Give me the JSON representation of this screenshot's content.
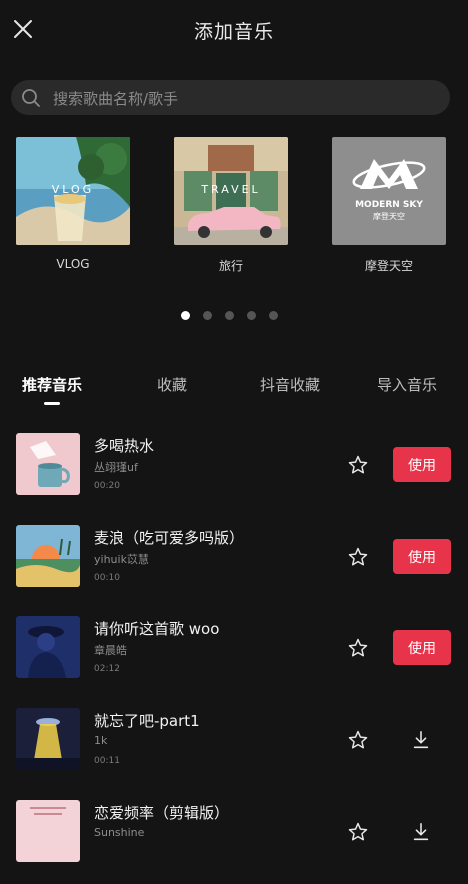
{
  "header": {
    "title": "添加音乐"
  },
  "search": {
    "placeholder": "搜索歌曲名称/歌手"
  },
  "categories": [
    {
      "label": "VLOG",
      "overlay": "VLOG",
      "thumb": "vlog-drink-photo"
    },
    {
      "label": "旅行",
      "overlay": "TRAVEL",
      "thumb": "travel-pink-car-photo"
    },
    {
      "label": "摩登天空",
      "overlay": "MODERN SKY",
      "overlay_sub": "摩登天空",
      "thumb": "modern-sky-logo"
    }
  ],
  "carousel": {
    "page_count": 5,
    "active_index": 0
  },
  "tabs": [
    {
      "label": "推荐音乐",
      "active": true
    },
    {
      "label": "收藏",
      "active": false
    },
    {
      "label": "抖音收藏",
      "active": false
    },
    {
      "label": "导入音乐",
      "active": false
    }
  ],
  "songs": [
    {
      "title": "多喝热水",
      "artist": "丛翊瑾uf",
      "duration": "00:20",
      "action": "使用",
      "cover": "pink-mug-cover"
    },
    {
      "title": "麦浪（吃可爱多吗版）",
      "artist": "yihuik苡慧",
      "duration": "00:10",
      "action": "使用",
      "cover": "sunset-field-cover"
    },
    {
      "title": "请你听这首歌 woo",
      "artist": "章晨皓",
      "duration": "02:12",
      "action": "使用",
      "cover": "blue-portrait-cover"
    },
    {
      "title": "就忘了吧-part1",
      "artist": "1k",
      "duration": "00:11",
      "action": "download",
      "cover": "ufo-beam-cover"
    },
    {
      "title": "恋爱频率（剪辑版）",
      "artist": "Sunshine",
      "duration": "",
      "action": "download",
      "cover": "pink-text-cover"
    }
  ],
  "colors": {
    "background": "#141414",
    "accent": "#e8344a",
    "search_bg": "#2a2a2a"
  },
  "icons": {
    "close": "close-icon",
    "search": "search-icon",
    "favorite": "star-icon",
    "download": "download-icon"
  }
}
